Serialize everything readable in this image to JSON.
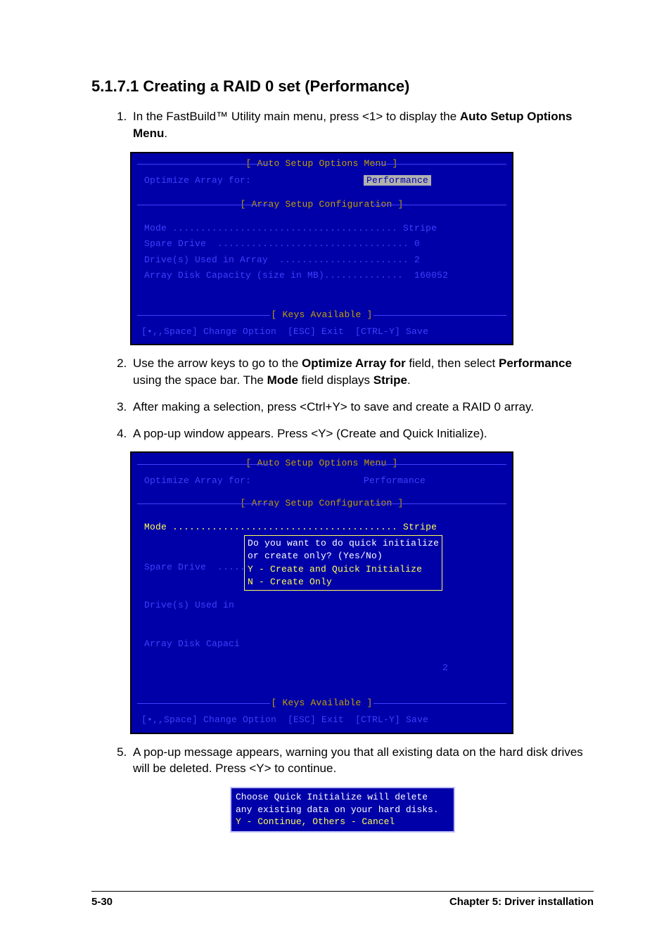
{
  "heading": "5.1.7.1 Creating a RAID 0 set (Performance)",
  "step1": {
    "num": "1.",
    "pre": "In the FastBuild™ Utility main menu, press <1> to display the ",
    "bold1": "Auto Setup Options Menu",
    "post": "."
  },
  "bios1": {
    "title1": "[ Auto Setup Options Menu ]",
    "opt_label": "Optimize Array for:",
    "opt_value": "Performance",
    "title2": "[ Array Setup Configuration ]",
    "rows": {
      "mode": "Mode ........................................ Stripe",
      "spare": "Spare Drive  .................................. 0",
      "drives": "Drive(s) Used in Array  ....................... 2",
      "cap": "Array Disk Capacity (size in MB)..............  160052"
    },
    "title3": "[ Keys Available ]",
    "keys": "[•,,Space] Change Option  [ESC] Exit  [CTRL-Y] Save"
  },
  "step2": {
    "num": "2.",
    "t1": "Use the arrow keys to go to the ",
    "b1": "Optimize Array for",
    "t2": " field, then select ",
    "b2": "Performance",
    "t3": " using the space bar. The ",
    "b3": "Mode",
    "t4": " field displays ",
    "b4": "Stripe",
    "t5": "."
  },
  "step3": {
    "num": "3.",
    "text": "After making a selection, press <Ctrl+Y> to save and create a RAID 0 array."
  },
  "step4": {
    "num": "4.",
    "text": "A pop-up window appears. Press <Y> (Create and Quick Initialize)."
  },
  "bios2": {
    "title1": "[ Auto Setup Options Menu ]",
    "opt_label": "Optimize Array for:",
    "opt_value": "Performance",
    "title2": "[ Array Setup Configuration ]",
    "mode_line": "Mode ........................................ Stripe",
    "left1": "Spare Drive  .....",
    "left2": "Drive(s) Used in ",
    "left3": "Array Disk Capaci",
    "popup_l1": "Do you want to do quick initialize",
    "popup_l2": "or create only? (Yes/No)",
    "popup_l3": "Y - Create and Quick Initialize",
    "popup_l4": "N - Create Only",
    "trail": " 2",
    "title3": "[ Keys Available ]",
    "keys": "[•,,Space] Change Option  [ESC] Exit  [CTRL-Y] Save"
  },
  "step5": {
    "num": "5.",
    "text": "A pop-up message appears, warning you that all existing data on the hard disk drives will be deleted. Press <Y> to continue."
  },
  "warn": {
    "l1": "Choose Quick Initialize will delete",
    "l2": "any existing data on your hard disks.",
    "l3": "Y - Continue, Others - Cancel"
  },
  "footer": {
    "left": "5-30",
    "right": "Chapter 5:  Driver installation"
  }
}
